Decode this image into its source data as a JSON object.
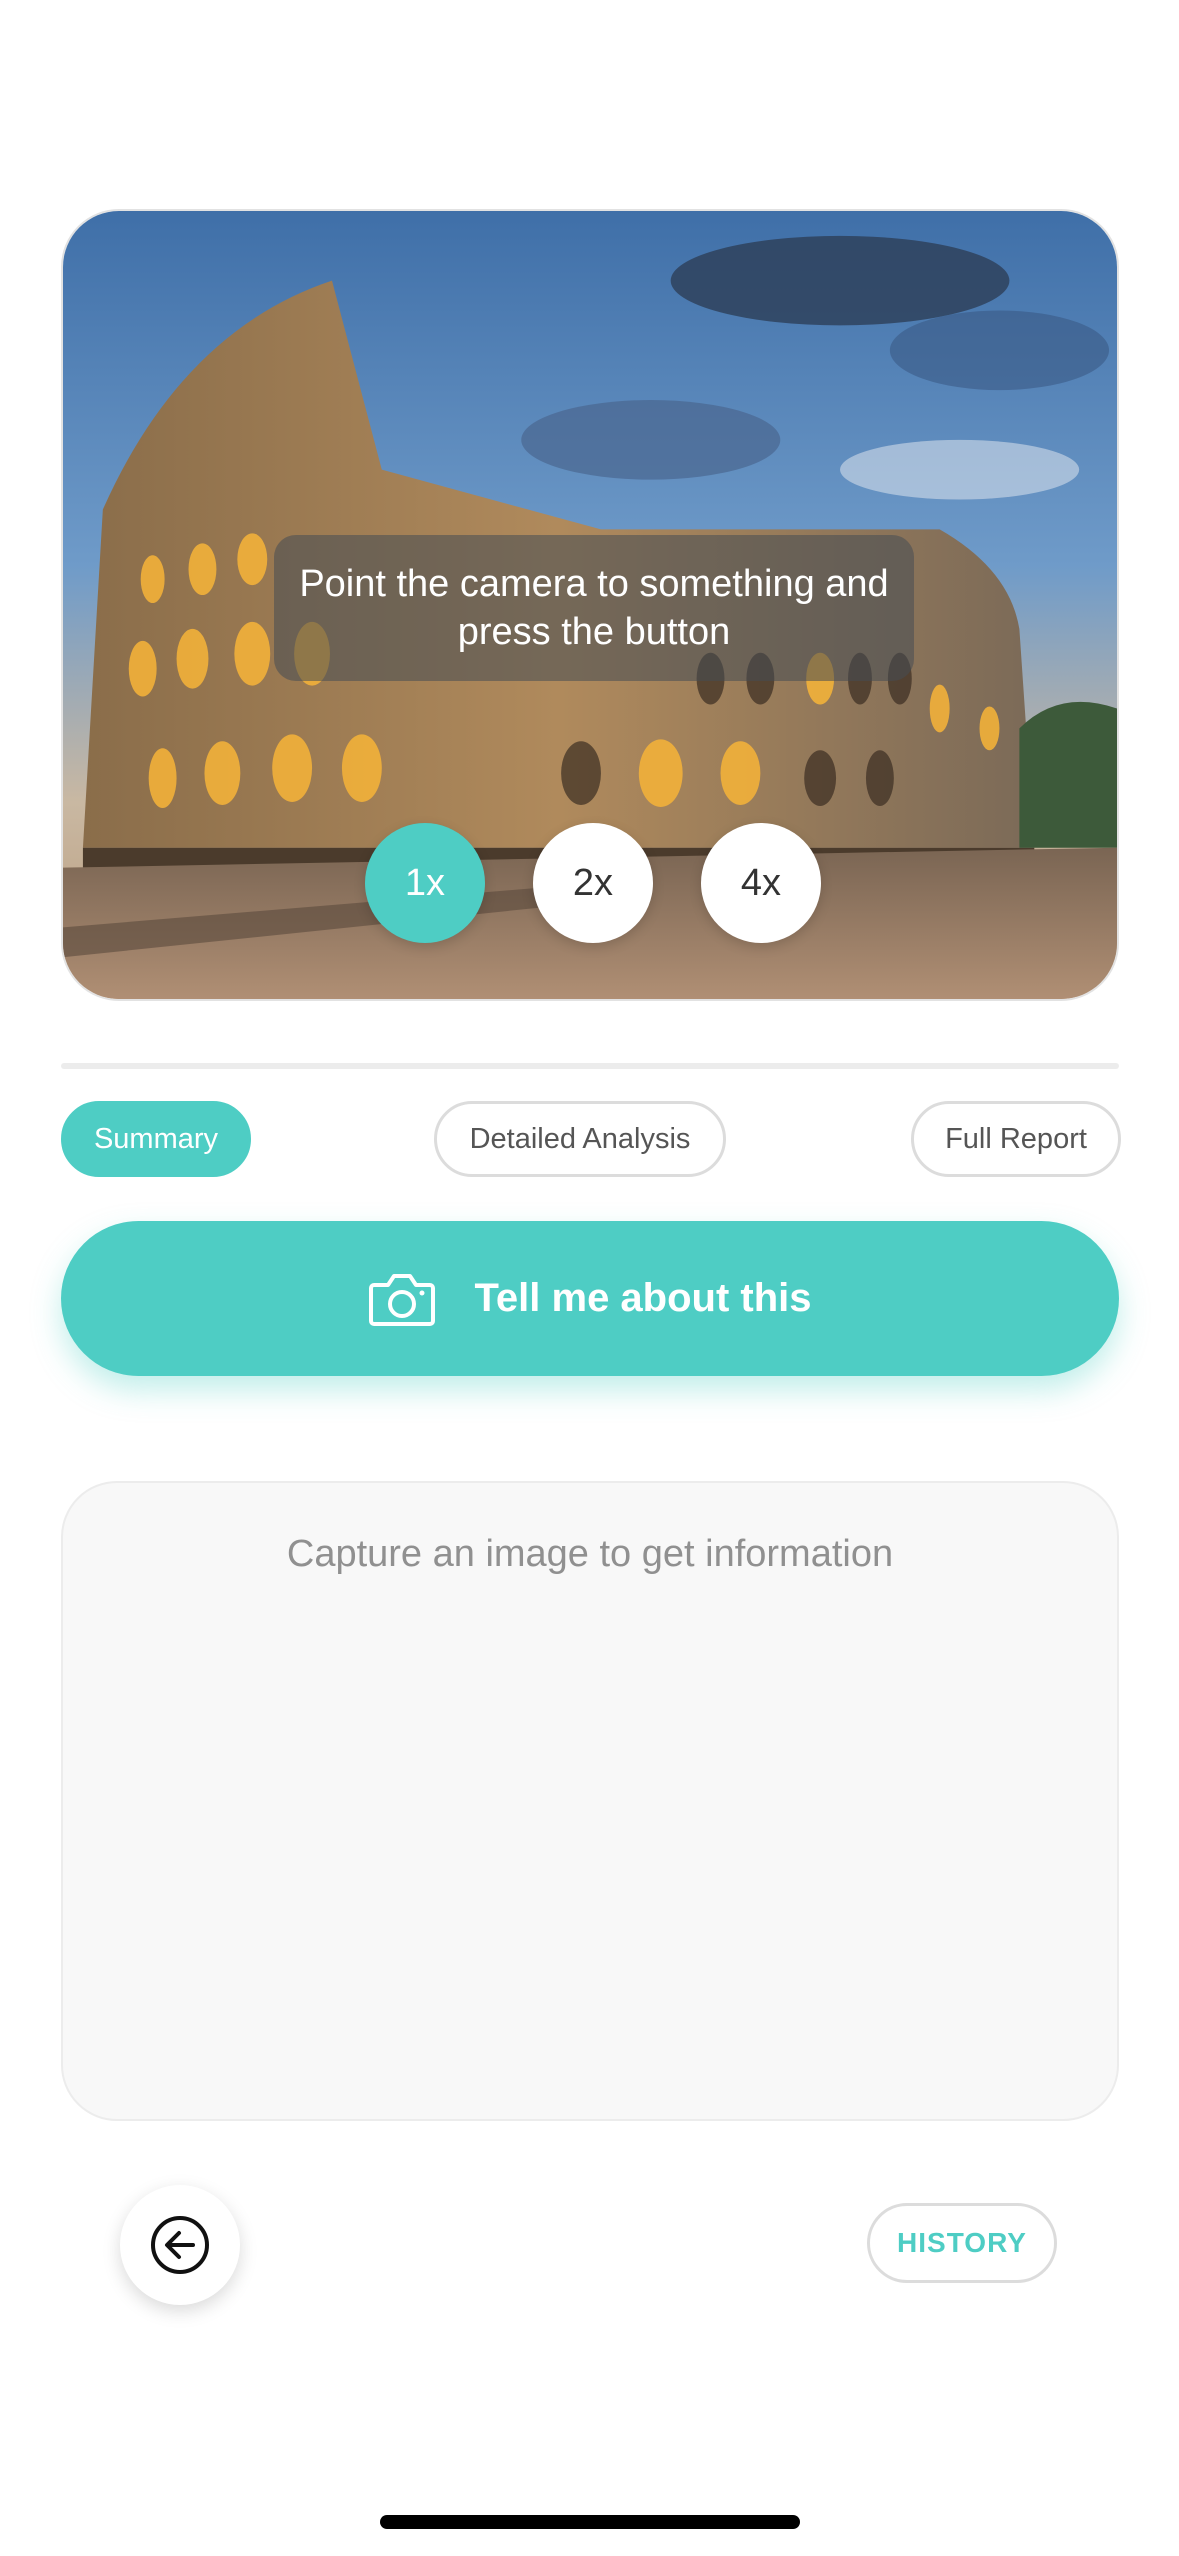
{
  "camera": {
    "hint": "Point the camera to something and press the button",
    "zoom_levels": [
      {
        "label": "1x",
        "active": true
      },
      {
        "label": "2x",
        "active": false
      },
      {
        "label": "4x",
        "active": false
      }
    ]
  },
  "tabs": [
    {
      "label": "Summary",
      "active": true
    },
    {
      "label": "Detailed Analysis",
      "active": false
    },
    {
      "label": "Full Report",
      "active": false
    }
  ],
  "primary_button": {
    "label": "Tell me about this",
    "icon": "camera-icon"
  },
  "result": {
    "placeholder": "Capture an image to get information"
  },
  "footer": {
    "back_icon": "arrow-left-circle-icon",
    "history_label": "HISTORY"
  },
  "colors": {
    "accent": "#4ecdc4",
    "background": "#ffffff",
    "panel": "#f8f8f8"
  }
}
